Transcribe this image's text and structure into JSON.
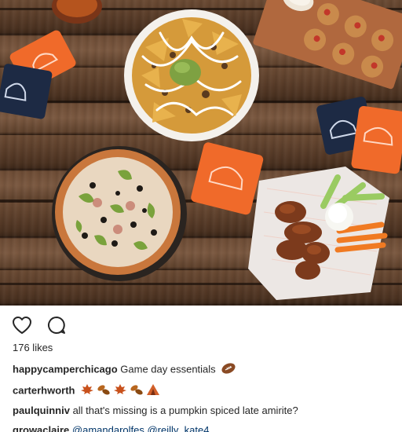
{
  "post": {
    "likes": "176 likes",
    "caption": {
      "user": "happycamperchicago",
      "text": " Game day essentials"
    },
    "comments": [
      {
        "user": "carterhworth",
        "text": ""
      },
      {
        "user": "paulquinniv",
        "text": " all that's missing is a pumpkin spiced late amirite?"
      },
      {
        "user": "growaclaire",
        "text": " ",
        "mentions": [
          "@amandarolfes",
          "@reilly_kate4"
        ]
      }
    ]
  },
  "icons": {
    "like": "heart-outline-icon",
    "comment": "speech-bubble-icon",
    "football": "american-football-emoji",
    "leaf": "maple-leaf-emoji",
    "leaves": "fallen-leaves-emoji",
    "tent": "tent-emoji"
  },
  "colors": {
    "text": "#262626",
    "mention": "#003569",
    "koozie_orange": "#f06a2a",
    "koozie_navy": "#1d2a44"
  }
}
